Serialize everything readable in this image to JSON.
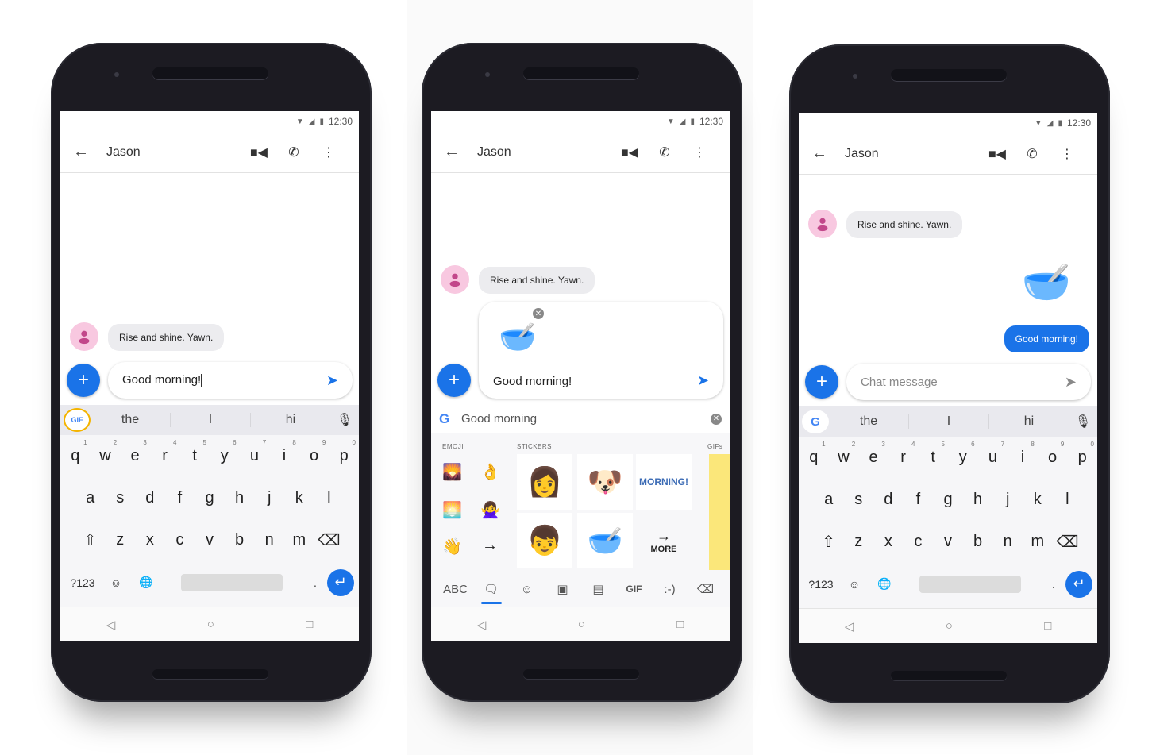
{
  "colors": {
    "accent": "#1a73e8",
    "bubble_in": "#ececef",
    "avatar_bg": "#f8c8e0",
    "bezel": "#1c1b22"
  },
  "phones": [
    {
      "status": {
        "wifi_icon": "wifi-icon",
        "signal_icon": "signal-icon",
        "battery_icon": "battery-icon",
        "time": "12:30"
      },
      "appbar": {
        "back_icon": "arrow-back-icon",
        "title": "Jason",
        "video_icon": "videocam-icon",
        "call_icon": "phone-icon",
        "more_icon": "more-vert-icon"
      },
      "messages": [
        {
          "from": "contact",
          "text": "Rise and shine. Yawn."
        }
      ],
      "compose": {
        "value": "Good morning!",
        "placeholder": ""
      },
      "suggestion_bar": {
        "lead": "GIF",
        "suggestions": [
          "the",
          "I",
          "hi"
        ],
        "mic_icon": "mic-icon"
      },
      "keyboard": {
        "row1": [
          {
            "k": "q",
            "n": "1"
          },
          {
            "k": "w",
            "n": "2"
          },
          {
            "k": "e",
            "n": "3"
          },
          {
            "k": "r",
            "n": "4"
          },
          {
            "k": "t",
            "n": "5"
          },
          {
            "k": "y",
            "n": "6"
          },
          {
            "k": "u",
            "n": "7"
          },
          {
            "k": "i",
            "n": "8"
          },
          {
            "k": "o",
            "n": "9"
          },
          {
            "k": "p",
            "n": "0"
          }
        ],
        "row2": [
          "a",
          "s",
          "d",
          "f",
          "g",
          "h",
          "j",
          "k",
          "l"
        ],
        "row3": [
          "z",
          "x",
          "c",
          "v",
          "b",
          "n",
          "m"
        ],
        "symbols": "?123",
        "period": "."
      }
    },
    {
      "status": {
        "time": "12:30"
      },
      "appbar": {
        "title": "Jason"
      },
      "messages": [
        {
          "from": "contact",
          "text": "Rise and shine. Yawn."
        }
      ],
      "compose": {
        "value": "Good morning!",
        "attachment": "sleepy cereal and toast sticker"
      },
      "search": {
        "value": "Good morning"
      },
      "sections": {
        "emoji": "EMOJI",
        "stickers": "STICKERS",
        "gifs": "GIFs"
      },
      "emoji": [
        "🌄",
        "👌",
        "🌅",
        "🙅‍♀️",
        "👋",
        "→"
      ],
      "stickers": [
        "Good Morning girl",
        "Dog with mug",
        "MORNING!",
        "Good Morning boy",
        "Sleepy cereal and toast"
      ],
      "more_label": "MORE",
      "tabs": [
        "ABC",
        "sticker",
        "emoji",
        "bitmoji",
        "stickers",
        "GIF",
        ":-)"
      ]
    },
    {
      "status": {
        "time": "12:30"
      },
      "appbar": {
        "title": "Jason"
      },
      "messages": [
        {
          "from": "contact",
          "text": "Rise and shine. Yawn."
        },
        {
          "from": "me",
          "text": "Good morning!",
          "sticker": "sleepy cereal and toast"
        }
      ],
      "compose": {
        "value": "",
        "placeholder": "Chat message"
      },
      "suggestion_bar": {
        "lead": "G",
        "suggestions": [
          "the",
          "I",
          "hi"
        ]
      },
      "keyboard": {
        "symbols": "?123",
        "period": "."
      }
    }
  ]
}
